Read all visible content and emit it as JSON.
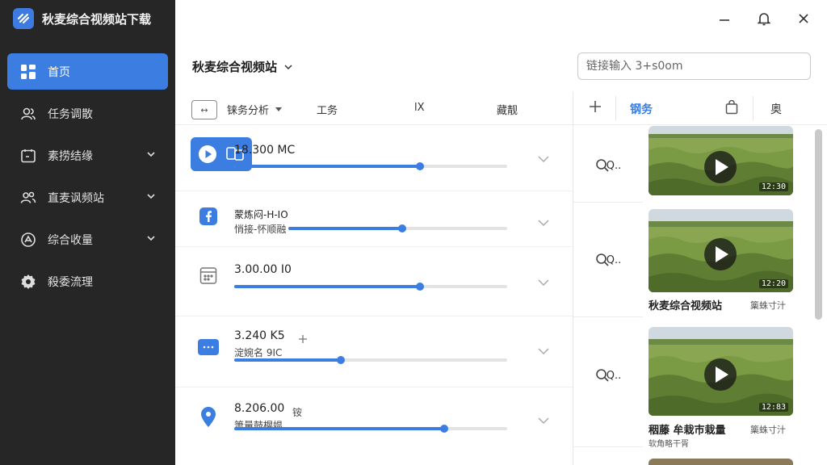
{
  "app": {
    "title": "秋麦综合视频站下载",
    "accent": "#3b7de1",
    "sidebar_bg": "#262626"
  },
  "window": {
    "controls": [
      "minimize-icon",
      "bell-icon",
      "close-icon"
    ]
  },
  "sidebar": {
    "items": [
      {
        "label": "首页",
        "icon": "grid-icon",
        "active": true,
        "has_chevron": false
      },
      {
        "label": "任务调散",
        "icon": "users-icon",
        "active": false,
        "has_chevron": false
      },
      {
        "label": "素捞结缘",
        "icon": "calendar-icon",
        "active": false,
        "has_chevron": true
      },
      {
        "label": "直麦讽频站",
        "icon": "user-group-icon",
        "active": false,
        "has_chevron": true
      },
      {
        "label": "综合收量",
        "icon": "chart-circle-icon",
        "active": false,
        "has_chevron": true
      },
      {
        "label": "殺委流理",
        "icon": "gear-icon",
        "active": false,
        "has_chevron": false
      }
    ]
  },
  "header": {
    "title": "秋麦综合视频站",
    "search_placeholder": "链接输入 3+s0om"
  },
  "toolbar": {
    "icon_text": "↔",
    "items": [
      "铼务分析",
      "工务",
      "lX",
      "藏靓"
    ]
  },
  "tabs": {
    "active": "钢务",
    "items": [
      "钢务",
      "奥"
    ]
  },
  "tasks": [
    {
      "title": "18.300 MC",
      "sub": "",
      "progress": 0.68
    },
    {
      "title": "蒙炼闷-H-IO",
      "sub": "悄接-怀顺融",
      "progress": 0.52
    },
    {
      "title": "3.00.00 I0",
      "sub": "",
      "progress": 0.68
    },
    {
      "title": "3.240 K5",
      "sub": "淀婉名 9IC",
      "progress": 0.39
    },
    {
      "title": "8.206.00",
      "sub": "箫量鼓榥媪",
      "extra": "铵",
      "progress": 0.77
    }
  ],
  "previews": [
    {
      "query": "Q..",
      "duration": "12:30",
      "title": "",
      "meta": "",
      "sub": ""
    },
    {
      "query": "Q..",
      "duration": "12:20",
      "title": "秋麦综合视频站",
      "meta": "篥蛛寸汁",
      "sub": ""
    },
    {
      "query": "Q..",
      "duration": "12:83",
      "title": "秵藤 牟栽巿栽量",
      "meta": "篥蛛寸汁",
      "sub": "软角略干胥"
    }
  ]
}
